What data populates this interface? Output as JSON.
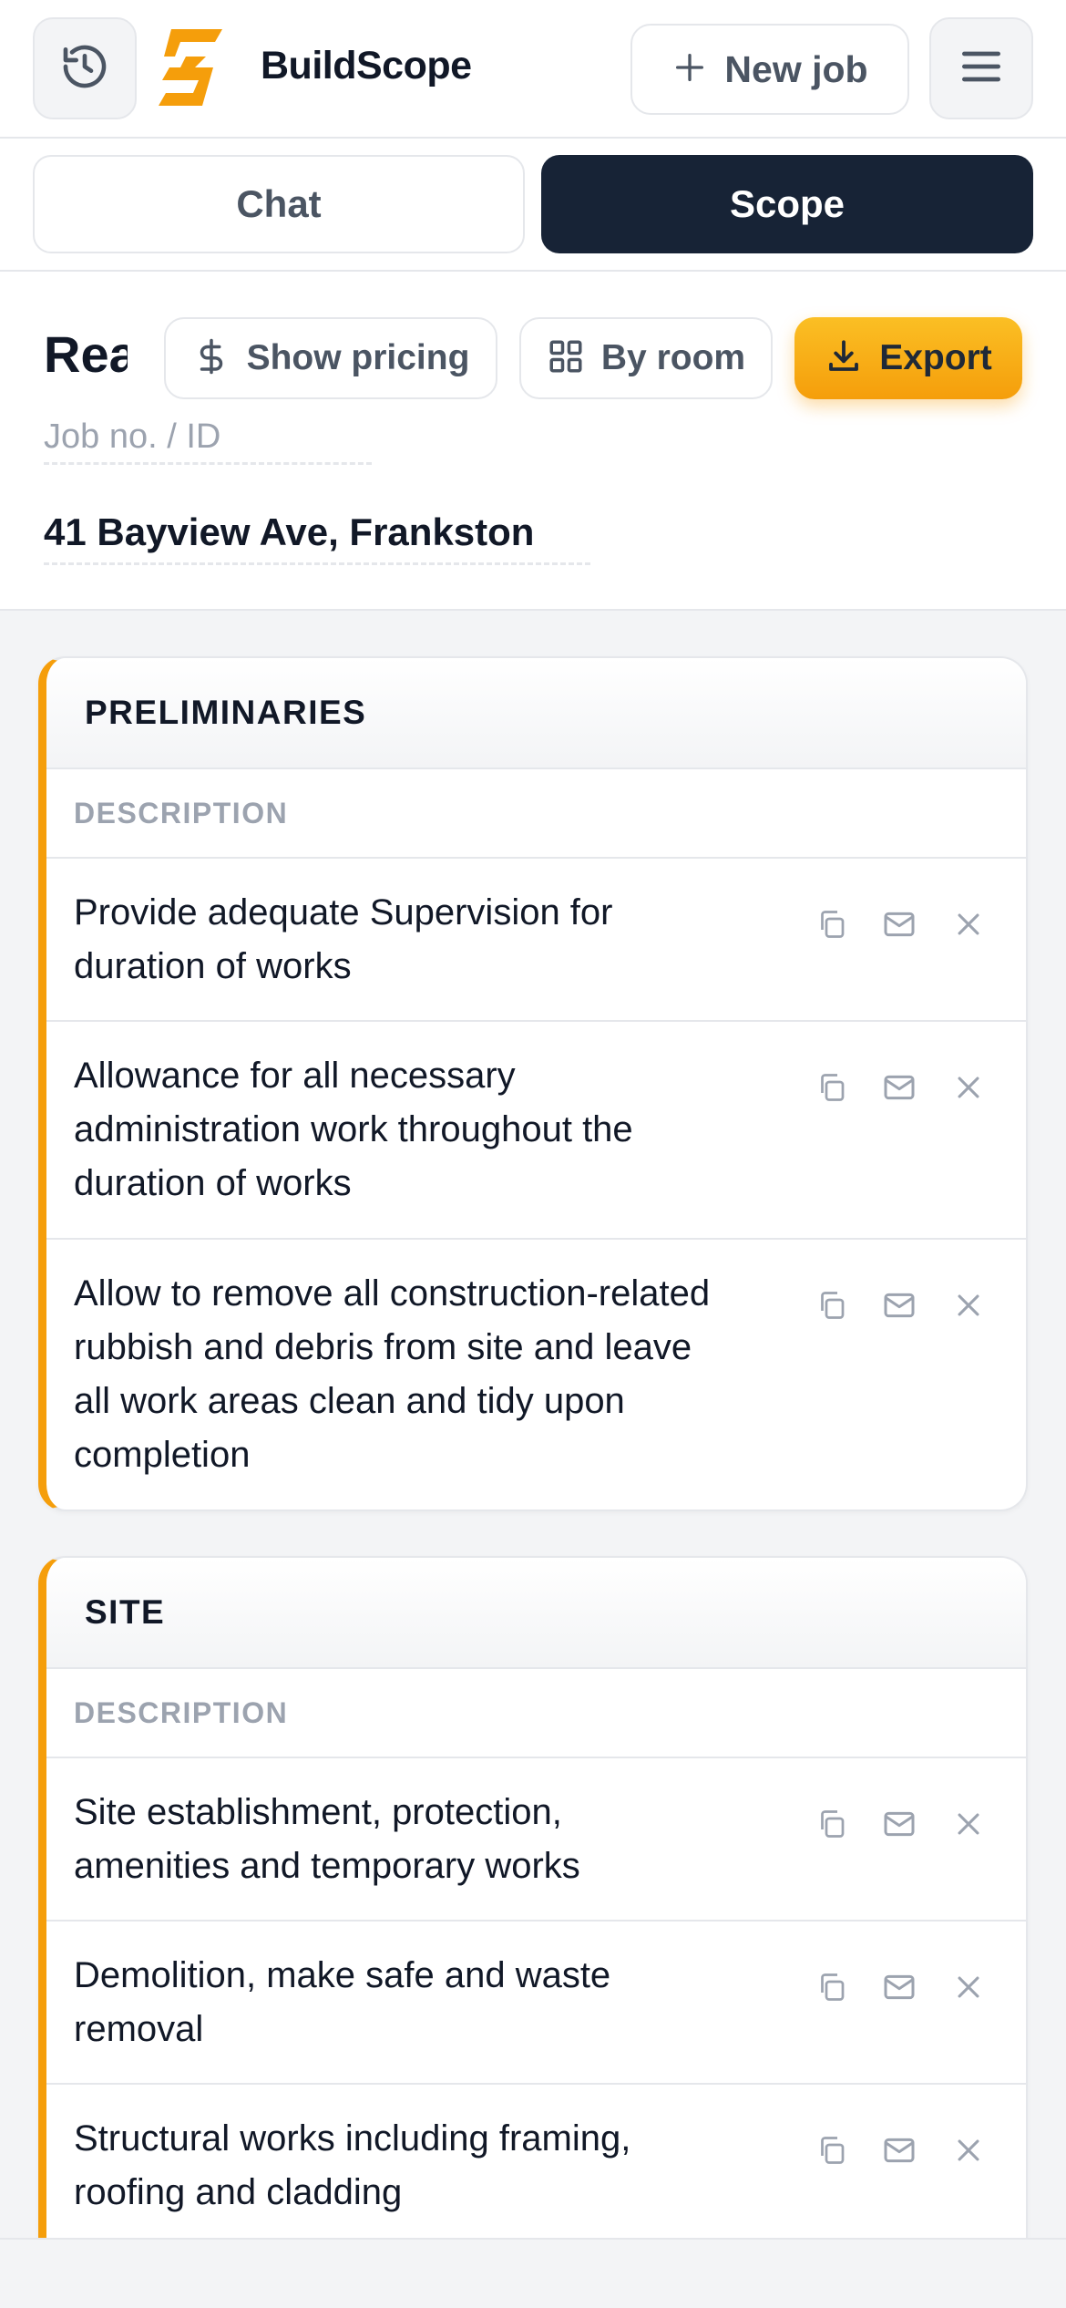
{
  "header": {
    "brand": "BuildScope",
    "new_job_label": "New job",
    "icons": {
      "history": "history-icon",
      "plus": "plus-icon",
      "menu": "hamburger-menu-icon",
      "logo": "buildscope-logo"
    }
  },
  "tabs": [
    {
      "label": "Chat",
      "active": false
    },
    {
      "label": "Scope",
      "active": true
    }
  ],
  "job": {
    "title": "Rea",
    "job_no_placeholder": "Job no. / ID",
    "address": "41 Bayview Ave, Frankston",
    "actions": {
      "show_pricing": "Show pricing",
      "by_room": "By room",
      "export": "Export"
    }
  },
  "colors": {
    "accent": "#f59e0b",
    "dark": "#172336",
    "muted": "#9ca3af"
  },
  "sections": [
    {
      "title": "PRELIMINARIES",
      "column": "DESCRIPTION",
      "rows": [
        "Provide adequate Supervision for duration of works",
        "Allowance for all necessary administration work throughout the duration of works",
        "Allow to remove all construction-related rubbish and debris from site and leave all work areas clean and tidy upon completion"
      ]
    },
    {
      "title": "SITE",
      "column": "DESCRIPTION",
      "rows": [
        "Site establishment, protection, amenities and temporary works",
        "Demolition, make safe and waste removal",
        "Structural works including framing, roofing and cladding"
      ]
    }
  ]
}
